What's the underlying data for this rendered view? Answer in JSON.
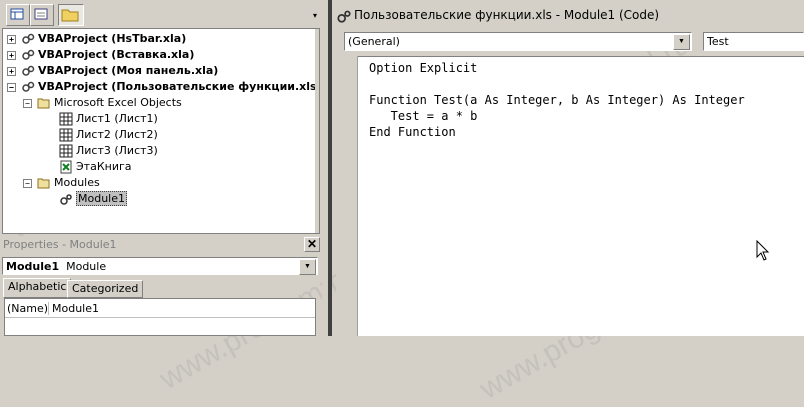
{
  "project_tree": {
    "projects": [
      {
        "label": "VBAProject (HsTbar.xla)",
        "expander": "+"
      },
      {
        "label": "VBAProject (Вставка.xla)",
        "expander": "+"
      },
      {
        "label": "VBAProject (Моя панель.xla)",
        "expander": "+"
      },
      {
        "label": "VBAProject (Пользовательские функции.xls)",
        "expander": "−"
      }
    ],
    "folders": {
      "excel_objects": {
        "label": "Microsoft Excel Objects",
        "expander": "−"
      },
      "sheet1": "Лист1 (Лист1)",
      "sheet2": "Лист2 (Лист2)",
      "sheet3": "Лист3 (Лист3)",
      "workbook": "ЭтаКнига",
      "modules": {
        "label": "Modules",
        "expander": "−"
      },
      "module1": "Module1"
    }
  },
  "properties": {
    "title": "Properties - Module1",
    "close_glyph": "✕",
    "object_name": "Module1",
    "object_type": "Module",
    "tabs": [
      "Alphabetic",
      "Categorized"
    ],
    "rows": [
      {
        "name": "(Name)",
        "value": "Module1"
      }
    ]
  },
  "code_window": {
    "title": "Пользовательские функции.xls - Module1 (Code)",
    "object_combo": "(General)",
    "proc_combo": "Test",
    "code": "Option Explicit\n\nFunction Test(a As Integer, b As Integer) As Integer\n   Test = a * b\nEnd Function"
  },
  "watermark": "www.programm-school.ru",
  "colors": {
    "panel": "#d4d0c8",
    "window": "#ffffff",
    "shadow": "#808080"
  }
}
